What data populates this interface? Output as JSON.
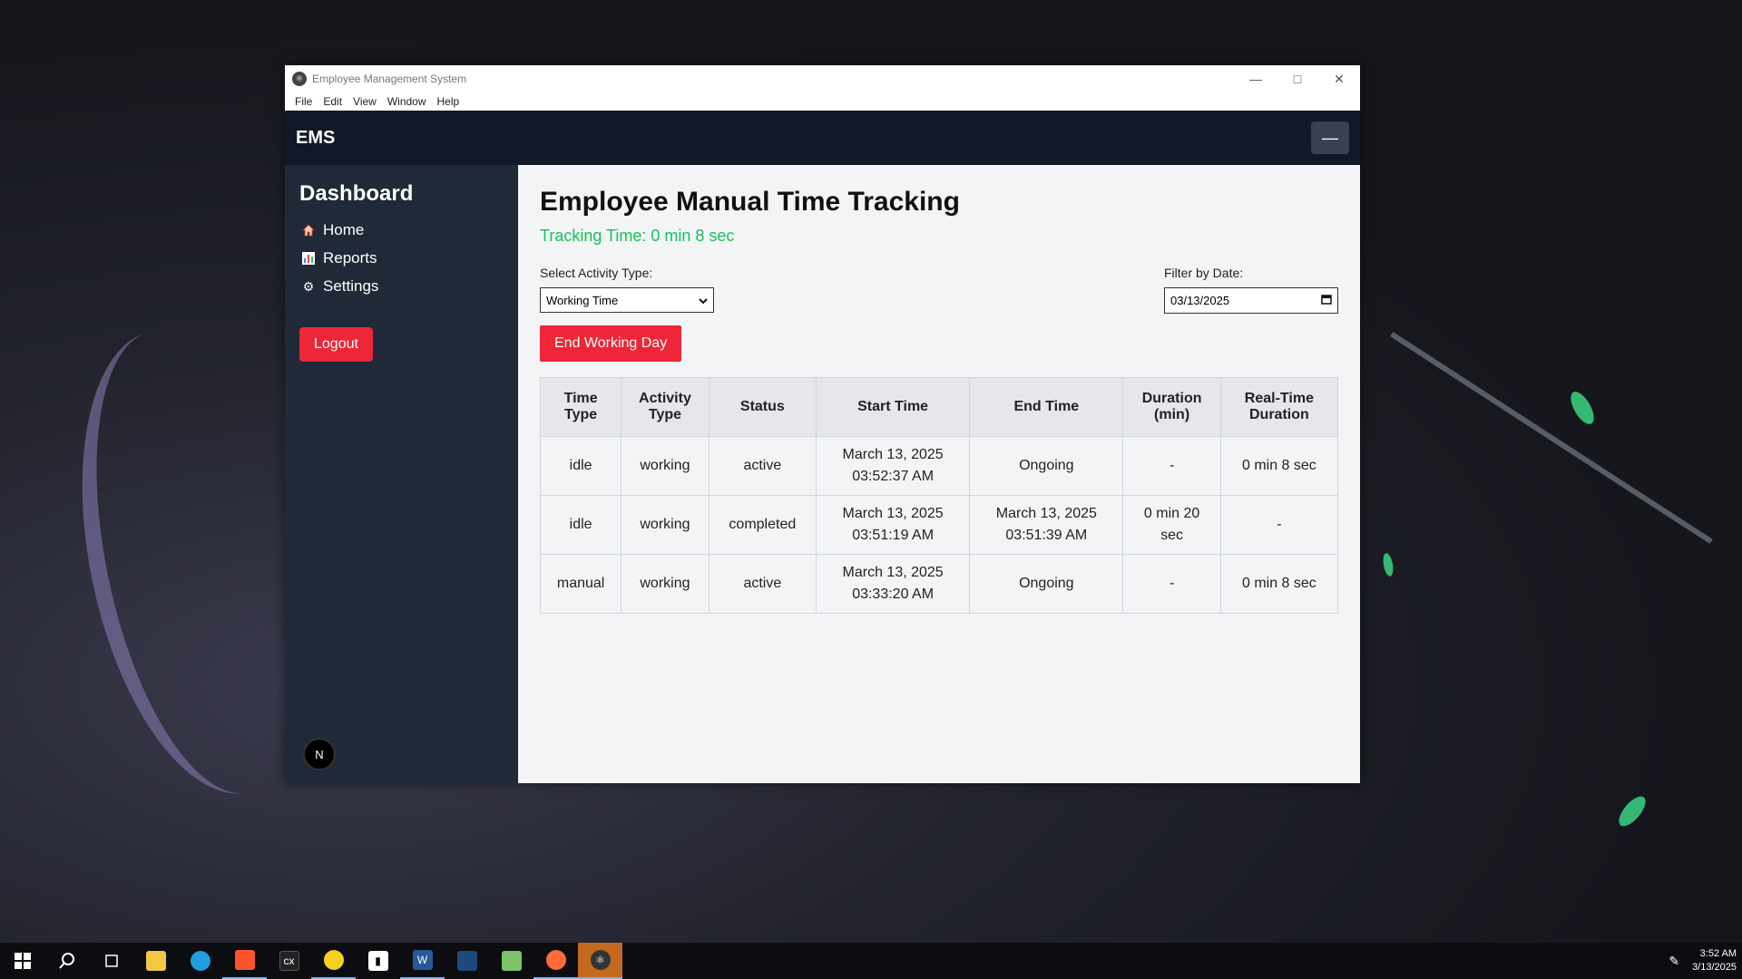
{
  "window": {
    "title": "Employee Management System",
    "menu": [
      "File",
      "Edit",
      "View",
      "Window",
      "Help"
    ]
  },
  "topnav": {
    "brand": "EMS",
    "collapse_label": "—"
  },
  "sidebar": {
    "title": "Dashboard",
    "items": [
      {
        "label": "Home",
        "icon": "home-icon"
      },
      {
        "label": "Reports",
        "icon": "chart-icon"
      },
      {
        "label": "Settings",
        "icon": "gear-icon"
      }
    ],
    "logout_label": "Logout",
    "avatar_letter": "N"
  },
  "main": {
    "title": "Employee Manual Time Tracking",
    "tracking_text": "Tracking Time: 0 min 8 sec",
    "activity_label": "Select Activity Type:",
    "activity_value": "Working Time",
    "date_label": "Filter by Date:",
    "date_value": "03/13/2025",
    "end_button": "End Working Day",
    "accent_green": "#16c25a",
    "accent_red": "#ef2637",
    "table": {
      "headers": [
        [
          "Time",
          "Type"
        ],
        [
          "Activity",
          "Type"
        ],
        [
          "Status"
        ],
        [
          "Start Time"
        ],
        [
          "End Time"
        ],
        [
          "Duration",
          "(min)"
        ],
        [
          "Real-Time",
          "Duration"
        ]
      ],
      "rows": [
        {
          "time_type": "idle",
          "activity": "working",
          "status": "active",
          "start": [
            "March 13, 2025",
            "03:52:37 AM"
          ],
          "end": [
            "Ongoing"
          ],
          "duration": [
            "-"
          ],
          "realtime": "0 min 8 sec"
        },
        {
          "time_type": "idle",
          "activity": "working",
          "status": "completed",
          "start": [
            "March 13, 2025",
            "03:51:19 AM"
          ],
          "end": [
            "March 13, 2025",
            "03:51:39 AM"
          ],
          "duration": [
            "0 min 20",
            "sec"
          ],
          "realtime": "-"
        },
        {
          "time_type": "manual",
          "activity": "working",
          "status": "active",
          "start": [
            "March 13, 2025",
            "03:33:20 AM"
          ],
          "end": [
            "Ongoing"
          ],
          "duration": [
            "-"
          ],
          "realtime": "0 min 8 sec"
        }
      ]
    }
  },
  "taskbar": {
    "clock_time": "3:52 AM",
    "clock_date": "3/13/2025"
  }
}
